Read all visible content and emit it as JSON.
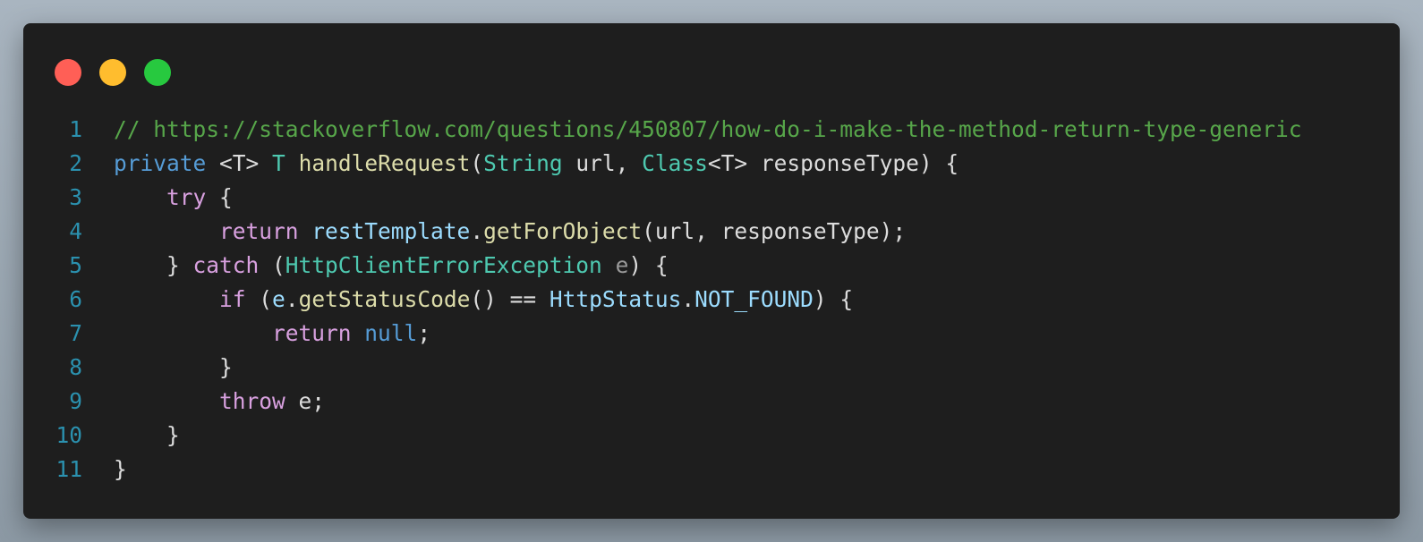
{
  "window": {
    "controls": [
      {
        "name": "close-dot",
        "color": "#ff5f56"
      },
      {
        "name": "minimize-dot",
        "color": "#ffbd2e"
      },
      {
        "name": "zoom-dot",
        "color": "#27c93f"
      }
    ]
  },
  "colors": {
    "background": "#1e1e1e",
    "line_number": "#2b91af",
    "comment": "#57a64a",
    "keyword_blue": "#569cd6",
    "keyword_control": "#d8a0df",
    "type": "#4ec9b0",
    "method": "#dcdcaa",
    "variable": "#9cdcfe",
    "plain": "#dcdcdc",
    "param": "#9a9a9a"
  },
  "code": {
    "lines": [
      {
        "number": "1",
        "tokens": [
          {
            "t": "// https://stackoverflow.com/questions/450807/how-do-i-make-the-method-return-type-generic",
            "c": "comment"
          }
        ]
      },
      {
        "number": "2",
        "tokens": [
          {
            "t": "private",
            "c": "keyword_blue"
          },
          {
            "t": " <T> ",
            "c": "plain"
          },
          {
            "t": "T",
            "c": "type"
          },
          {
            "t": " ",
            "c": "plain"
          },
          {
            "t": "handleRequest",
            "c": "method"
          },
          {
            "t": "(",
            "c": "plain"
          },
          {
            "t": "String",
            "c": "type"
          },
          {
            "t": " url, ",
            "c": "plain"
          },
          {
            "t": "Class",
            "c": "type"
          },
          {
            "t": "<T> responseType) {",
            "c": "plain"
          }
        ]
      },
      {
        "number": "3",
        "tokens": [
          {
            "t": "    ",
            "c": "plain"
          },
          {
            "t": "try",
            "c": "keyword_control"
          },
          {
            "t": " {",
            "c": "plain"
          }
        ]
      },
      {
        "number": "4",
        "tokens": [
          {
            "t": "        ",
            "c": "plain"
          },
          {
            "t": "return",
            "c": "keyword_control"
          },
          {
            "t": " ",
            "c": "plain"
          },
          {
            "t": "restTemplate",
            "c": "variable"
          },
          {
            "t": ".",
            "c": "plain"
          },
          {
            "t": "getForObject",
            "c": "method"
          },
          {
            "t": "(url, responseType);",
            "c": "plain"
          }
        ]
      },
      {
        "number": "5",
        "tokens": [
          {
            "t": "    } ",
            "c": "plain"
          },
          {
            "t": "catch",
            "c": "keyword_control"
          },
          {
            "t": " (",
            "c": "plain"
          },
          {
            "t": "HttpClientErrorException",
            "c": "type"
          },
          {
            "t": " ",
            "c": "plain"
          },
          {
            "t": "e",
            "c": "param"
          },
          {
            "t": ") {",
            "c": "plain"
          }
        ]
      },
      {
        "number": "6",
        "tokens": [
          {
            "t": "        ",
            "c": "plain"
          },
          {
            "t": "if",
            "c": "keyword_control"
          },
          {
            "t": " (",
            "c": "plain"
          },
          {
            "t": "e",
            "c": "variable"
          },
          {
            "t": ".",
            "c": "plain"
          },
          {
            "t": "getStatusCode",
            "c": "method"
          },
          {
            "t": "() == ",
            "c": "plain"
          },
          {
            "t": "HttpStatus",
            "c": "variable"
          },
          {
            "t": ".",
            "c": "plain"
          },
          {
            "t": "NOT_FOUND",
            "c": "variable"
          },
          {
            "t": ") {",
            "c": "plain"
          }
        ]
      },
      {
        "number": "7",
        "tokens": [
          {
            "t": "            ",
            "c": "plain"
          },
          {
            "t": "return",
            "c": "keyword_control"
          },
          {
            "t": " ",
            "c": "plain"
          },
          {
            "t": "null",
            "c": "keyword_blue"
          },
          {
            "t": ";",
            "c": "plain"
          }
        ]
      },
      {
        "number": "8",
        "tokens": [
          {
            "t": "        }",
            "c": "plain"
          }
        ]
      },
      {
        "number": "9",
        "tokens": [
          {
            "t": "        ",
            "c": "plain"
          },
          {
            "t": "throw",
            "c": "keyword_control"
          },
          {
            "t": " e;",
            "c": "plain"
          }
        ]
      },
      {
        "number": "10",
        "tokens": [
          {
            "t": "    }",
            "c": "plain"
          }
        ]
      },
      {
        "number": "11",
        "tokens": [
          {
            "t": "}",
            "c": "plain"
          }
        ]
      }
    ]
  }
}
